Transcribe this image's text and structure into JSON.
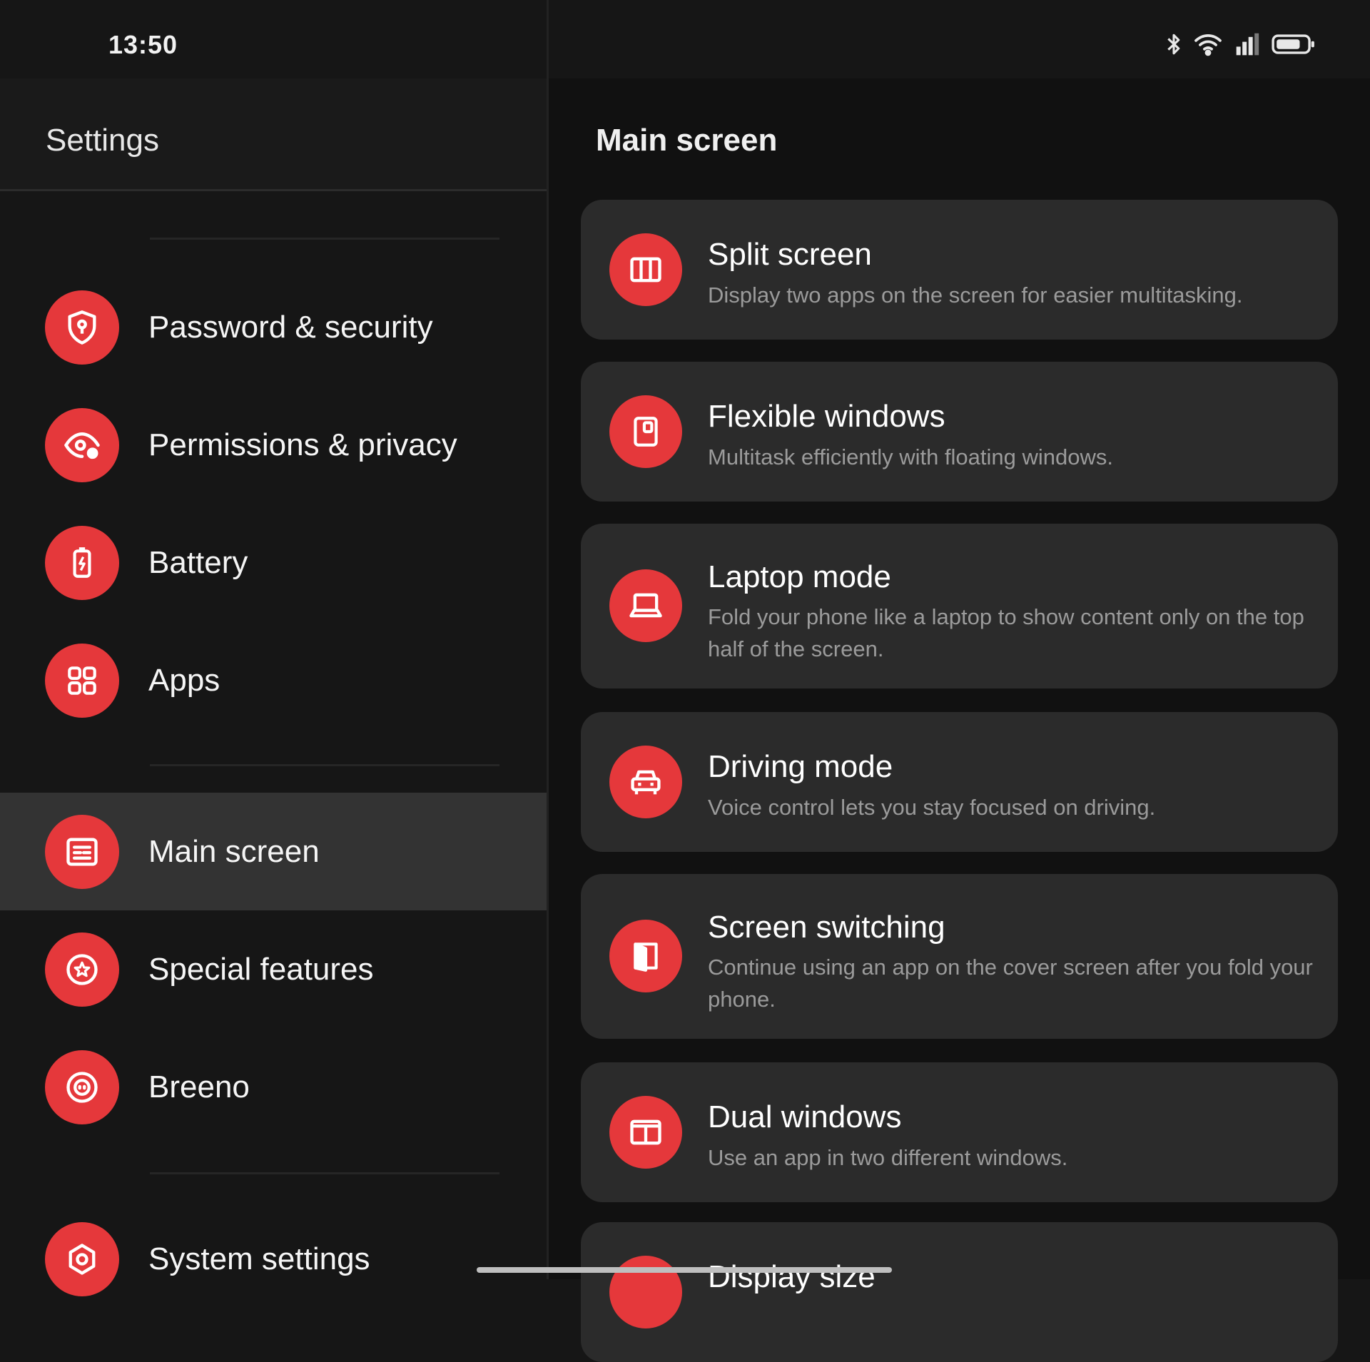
{
  "status_bar": {
    "time": "13:50",
    "icons": [
      "bluetooth-icon",
      "wifi-icon",
      "signal-icon",
      "battery-icon"
    ]
  },
  "colors": {
    "accent": "#e5383b",
    "background": "#161616",
    "card": "#2b2b2b",
    "selected": "#333333"
  },
  "sidebar": {
    "title": "Settings",
    "selected": "Main screen",
    "items": [
      {
        "label": "Password & security",
        "icon": "shield-icon"
      },
      {
        "label": "Permissions & privacy",
        "icon": "eye-lock-icon"
      },
      {
        "label": "Battery",
        "icon": "battery-charge-icon"
      },
      {
        "label": "Apps",
        "icon": "apps-grid-icon"
      },
      {
        "label": "Main screen",
        "icon": "main-screen-icon"
      },
      {
        "label": "Special features",
        "icon": "star-circle-icon"
      },
      {
        "label": "Breeno",
        "icon": "breeno-icon"
      },
      {
        "label": "System settings",
        "icon": "gear-icon"
      }
    ]
  },
  "main": {
    "title": "Main screen",
    "cards": [
      {
        "title": "Split screen",
        "description": "Display two apps on the screen for easier multitasking.",
        "icon": "split-screen-icon"
      },
      {
        "title": "Flexible windows",
        "description": "Multitask efficiently with floating windows.",
        "icon": "floating-window-icon"
      },
      {
        "title": "Laptop mode",
        "description": "Fold your phone like a laptop to show content only on the top half of the screen.",
        "icon": "laptop-icon"
      },
      {
        "title": "Driving mode",
        "description": "Voice control lets you stay focused on driving.",
        "icon": "car-icon"
      },
      {
        "title": "Screen switching",
        "description": "Continue using an app on the cover screen after you fold your phone.",
        "icon": "screen-switch-icon"
      },
      {
        "title": "Dual windows",
        "description": "Use an app in two different windows.",
        "icon": "dual-windows-icon"
      },
      {
        "title": "Display size",
        "description": "",
        "icon": "display-size-icon"
      }
    ]
  }
}
